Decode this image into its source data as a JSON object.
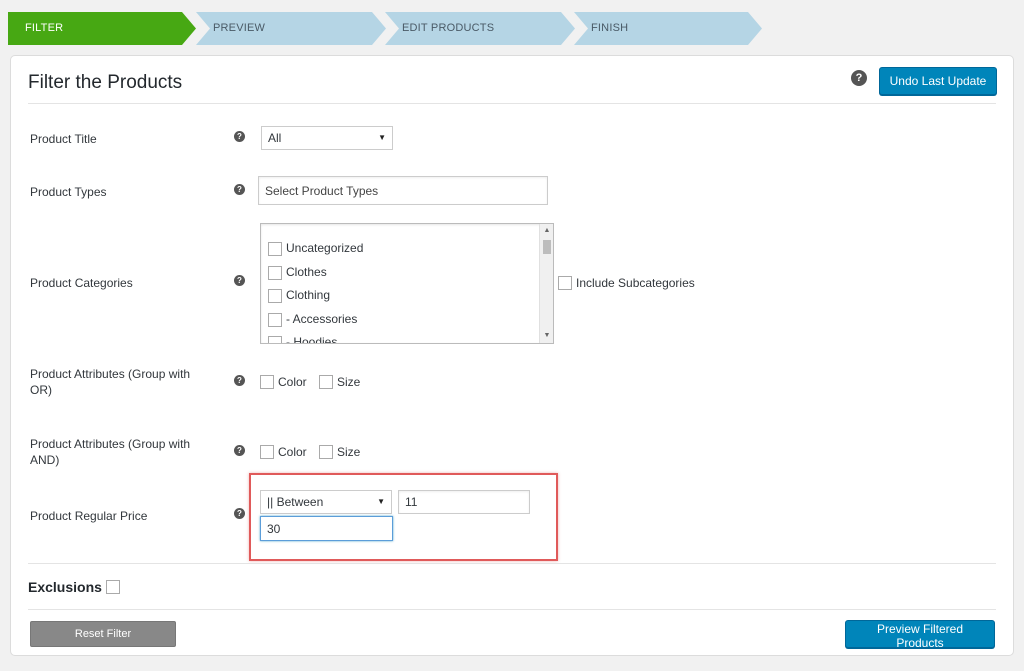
{
  "steps": [
    {
      "label": "FILTER",
      "active": true
    },
    {
      "label": "PREVIEW",
      "active": false
    },
    {
      "label": "EDIT PRODUCTS",
      "active": false
    },
    {
      "label": "FINISH",
      "active": false
    }
  ],
  "panel": {
    "title": "Filter the Products",
    "undo_label": "Undo Last Update"
  },
  "fields": {
    "title": {
      "label": "Product Title",
      "value": "All"
    },
    "types": {
      "label": "Product Types",
      "placeholder": "Select Product Types"
    },
    "categories": {
      "label": "Product Categories",
      "items": [
        "Uncategorized",
        "Clothes",
        "Clothing",
        "- Accessories",
        "- Hoodies"
      ],
      "include_sub_label": "Include Subcategories"
    },
    "attrs_or": {
      "label_line1": "Product Attributes (Group with",
      "label_line2": "OR)",
      "options": [
        "Color",
        "Size"
      ]
    },
    "attrs_and": {
      "label_line1": "Product Attributes (Group with",
      "label_line2": "AND)",
      "options": [
        "Color",
        "Size"
      ]
    },
    "price": {
      "label": "Product Regular Price",
      "operator": "|| Between",
      "min": "11",
      "max": "30"
    }
  },
  "exclusions_label": "Exclusions",
  "buttons": {
    "reset": "Reset Filter",
    "preview": "Preview Filtered Products"
  },
  "help_glyph": "?",
  "colors": {
    "active_step": "#47a813",
    "inactive_step": "#b5d5e5",
    "primary": "#0085ba",
    "highlight": "#e05a5a",
    "reset_btn": "#888888"
  }
}
